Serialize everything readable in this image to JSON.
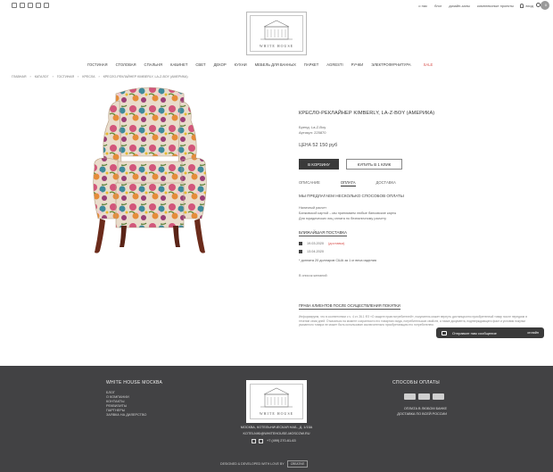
{
  "topbar": {
    "links": [
      "о нас",
      "блог",
      "дизайн-залы",
      "комплексные проекты"
    ],
    "login": "вход",
    "cart_count": "0"
  },
  "logo": {
    "text": "WHITE HOUSE"
  },
  "nav": {
    "items": [
      "ГОСТИНАЯ",
      "СТОЛОВАЯ",
      "СПАЛЬНЯ",
      "КАБИНЕТ",
      "СВЕТ",
      "ДЕКОР",
      "КУХНИ",
      "МЕБЕЛЬ ДЛЯ ВАННЫХ",
      "ПАРКЕТ",
      "AGRESTI",
      "РУЧКИ",
      "ЭЛЕКТРОФУРНИТУРА"
    ],
    "sale": "SALE"
  },
  "breadcrumb": [
    "ГЛАВНАЯ",
    "›",
    "КАТАЛОГ",
    "›",
    "ГОСТИНАЯ",
    "›",
    "КРЕСЛА",
    "›",
    "КРЕСЛО-РЕКЛАЙНЕР KIMBERLY, LA-Z-BOY (АМЕРИКА)"
  ],
  "product": {
    "title": "КРЕСЛО-РЕКЛАЙНЕР KIMBERLY, LA-Z-BOY (АМЕРИКА)",
    "brand_label": "Бренд:",
    "brand": "La-Z-Boy",
    "article_label": "Артикул:",
    "article": "225870",
    "price_label": "ЦЕНА",
    "price": "52 150 руб",
    "add_to_cart": "В КОРЗИНУ",
    "buy_one_click": "КУПИТЬ В 1 КЛИК",
    "tabs": [
      "ОПИСАНИЕ",
      "ОПЛАТА",
      "ДОСТАВКА"
    ],
    "active_tab": "ОПЛАТА",
    "pay_heading": "МЫ ПРЕДЛАГАЕМ НЕСКОЛЬКО СПОСОБОВ ОПЛАТЫ",
    "pay_lines": [
      "Наличный расчет",
      "Банковской картой – мы принимаем любые банковские карты",
      "Для юридических лиц оплата по безналичному расчету"
    ],
    "delivery_title": "БЛИЖАЙШАЯ ПОСТАВКА",
    "delivery_1_date": "19.03.2020",
    "delivery_1_note": "(доставка)",
    "delivery_2_date": "13.04.2020",
    "delivery_note": "* доплата 20 долларов США за 1 кг веса изделия",
    "wishlist": "В список желаний",
    "rights_title": "ПРАВА КЛИЕНТОВ ПОСЛЕ ОСУЩЕСТВЛЕНИЯ ПОКУПКИ",
    "rights_text": "Информируем, что в соответствии с ч. 4 ст. 26.1 ФЗ «О защите прав потребителей», покупатель может вернуть дистанционно приобретенный товар после передачи в течение семи дней. Отказаться на момент сохранности его товарного вида, потребительских свойств, а также документа, подтверждающего факт и условия покупки указанного товара не может быть использован исключительно приобретающим его потребителем."
  },
  "chat": {
    "label": "Отправьте нам сообщение",
    "status": "онлайн"
  },
  "footer": {
    "left_title": "WHITE HOUSE МОСКВА",
    "links": [
      "БЛОГ",
      "О КОМПАНИИ",
      "КОНТАКТЫ",
      "РЕКВИЗИТЫ",
      "ПАРТНЕРЫ",
      "ЗАЯВКА НА ДИЛЕРСТВО"
    ],
    "address": "МОСКВА, КОТЕЛЬНИЧЕСКАЯ НАБ., Д. 1/15А",
    "email": "KOTELNIKI@WHITEHOUSE-MOSCOW.RU",
    "phone": "+7 (499) 270-61-63",
    "right_title": "СПОСОБЫ ОПЛАТЫ",
    "pay_text_1": "ОПЛАТА В ЛЮБОМ БАНКЕ",
    "pay_text_2": "ДОСТАВКА ПО ВСЕЙ РОССИИ",
    "dev_text": "DESIGNED & DEVELOPED WITH LOVE BY",
    "dev_brand": "CREATIVE"
  }
}
